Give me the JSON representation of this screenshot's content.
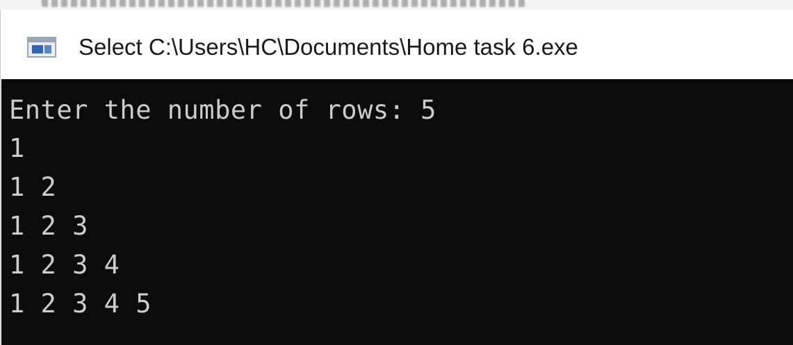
{
  "window": {
    "title": "Select C:\\Users\\HC\\Documents\\Home task 6.exe",
    "icon": "console-app-icon"
  },
  "console": {
    "lines": [
      "Enter the number of rows: 5",
      "1",
      "1 2",
      "1 2 3",
      "1 2 3 4",
      "1 2 3 4 5"
    ],
    "background_color": "#0c0c0c",
    "text_color": "#cccccc"
  }
}
